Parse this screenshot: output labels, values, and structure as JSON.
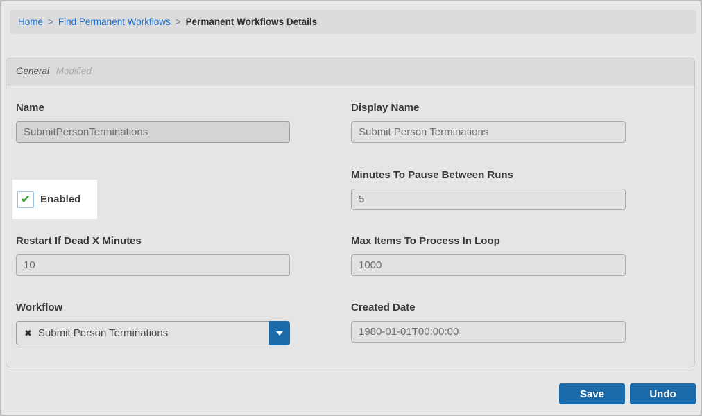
{
  "colors": {
    "accent_blue": "#1b6aa9",
    "link_blue": "#1d70d1",
    "check_green": "#2f9e2f",
    "checkbox_border_blue": "#9cc4e4"
  },
  "breadcrumb": {
    "separator": ">",
    "items": [
      {
        "label": "Home"
      },
      {
        "label": "Find Permanent Workflows"
      }
    ],
    "current": "Permanent Workflows Details"
  },
  "panel": {
    "title": "General",
    "status": "Modified"
  },
  "form": {
    "name": {
      "label": "Name",
      "value": "SubmitPersonTerminations",
      "disabled": true
    },
    "display_name": {
      "label": "Display Name",
      "value": "Submit Person Terminations"
    },
    "enabled": {
      "label": "Enabled",
      "checked": true,
      "check_glyph": "✔"
    },
    "minutes_to_pause": {
      "label": "Minutes To Pause Between Runs",
      "value": "5"
    },
    "restart_if_dead": {
      "label": "Restart If Dead X Minutes",
      "value": "10"
    },
    "max_items": {
      "label": "Max Items To Process In Loop",
      "value": "1000"
    },
    "workflow": {
      "label": "Workflow",
      "value": "Submit Person Terminations",
      "remove_glyph": "✖"
    },
    "created_date": {
      "label": "Created Date",
      "value": "1980-01-01T00:00:00"
    }
  },
  "actions": {
    "save_label": "Save",
    "undo_label": "Undo"
  }
}
